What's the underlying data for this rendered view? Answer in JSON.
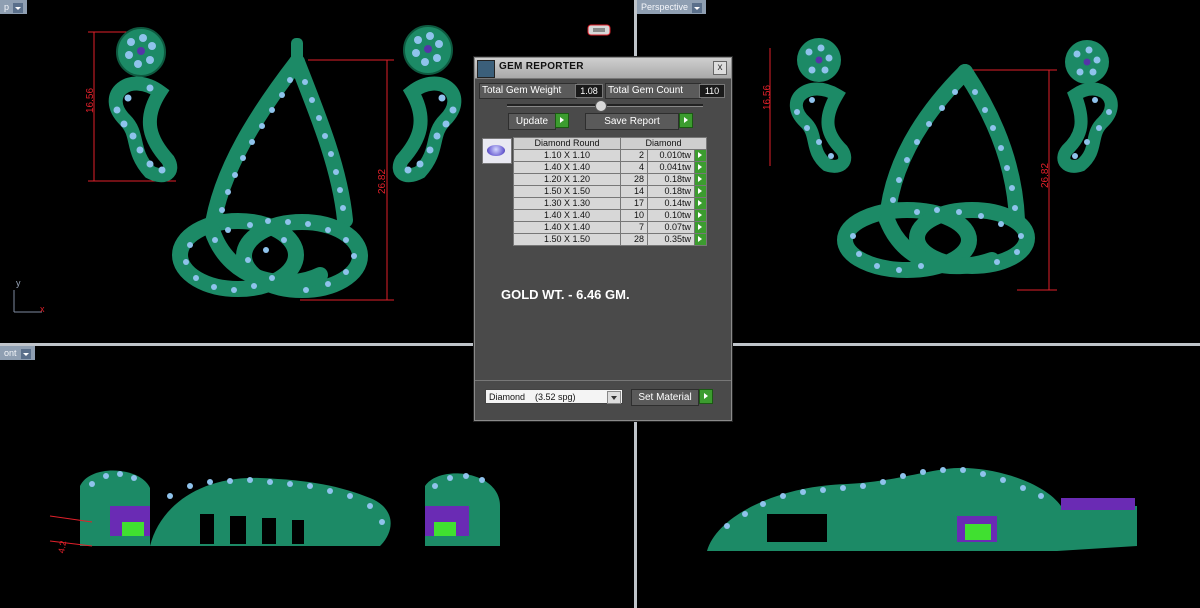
{
  "viewports": {
    "top_left_label": "p",
    "top_right_label": "Perspective",
    "bottom_left_label": "ont",
    "dims": {
      "left_height": "16.56",
      "main_height": "26.82",
      "right_height": "16.56",
      "right_main_height": "26.82",
      "side_small": "4.2"
    },
    "axis_y": "y",
    "axis_x": "x"
  },
  "panel": {
    "title": "GEM REPORTER",
    "close": "x",
    "total_weight_label": "Total Gem Weight",
    "total_weight_value": "1.08",
    "total_count_label": "Total Gem Count",
    "total_count_value": "110",
    "update_label": "Update",
    "save_label": "Save Report",
    "table_header_shape": "Diamond Round",
    "table_header_material": "Diamond",
    "rows": [
      {
        "size": "1.10 X 1.10",
        "count": "2",
        "weight": "0.010tw"
      },
      {
        "size": "1.40 X 1.40",
        "count": "4",
        "weight": "0.041tw"
      },
      {
        "size": "1.20 X 1.20",
        "count": "28",
        "weight": "0.18tw"
      },
      {
        "size": "1.50 X 1.50",
        "count": "14",
        "weight": "0.18tw"
      },
      {
        "size": "1.30 X 1.30",
        "count": "17",
        "weight": "0.14tw"
      },
      {
        "size": "1.40 X 1.40",
        "count": "10",
        "weight": "0.10tw"
      },
      {
        "size": "1.40 X 1.40",
        "count": "7",
        "weight": "0.07tw"
      },
      {
        "size": "1.50 X 1.50",
        "count": "28",
        "weight": "0.35tw"
      }
    ],
    "gold_weight": "GOLD WT. - 6.46 GM.",
    "material_select": "Diamond    (3.52 spg)",
    "set_material_label": "Set Material"
  },
  "colors": {
    "metal": "#1c8a66",
    "gem": "#8fc3ec",
    "gem_center": "#5535a8",
    "dimension": "#e0202a",
    "setting": "#40e030"
  }
}
